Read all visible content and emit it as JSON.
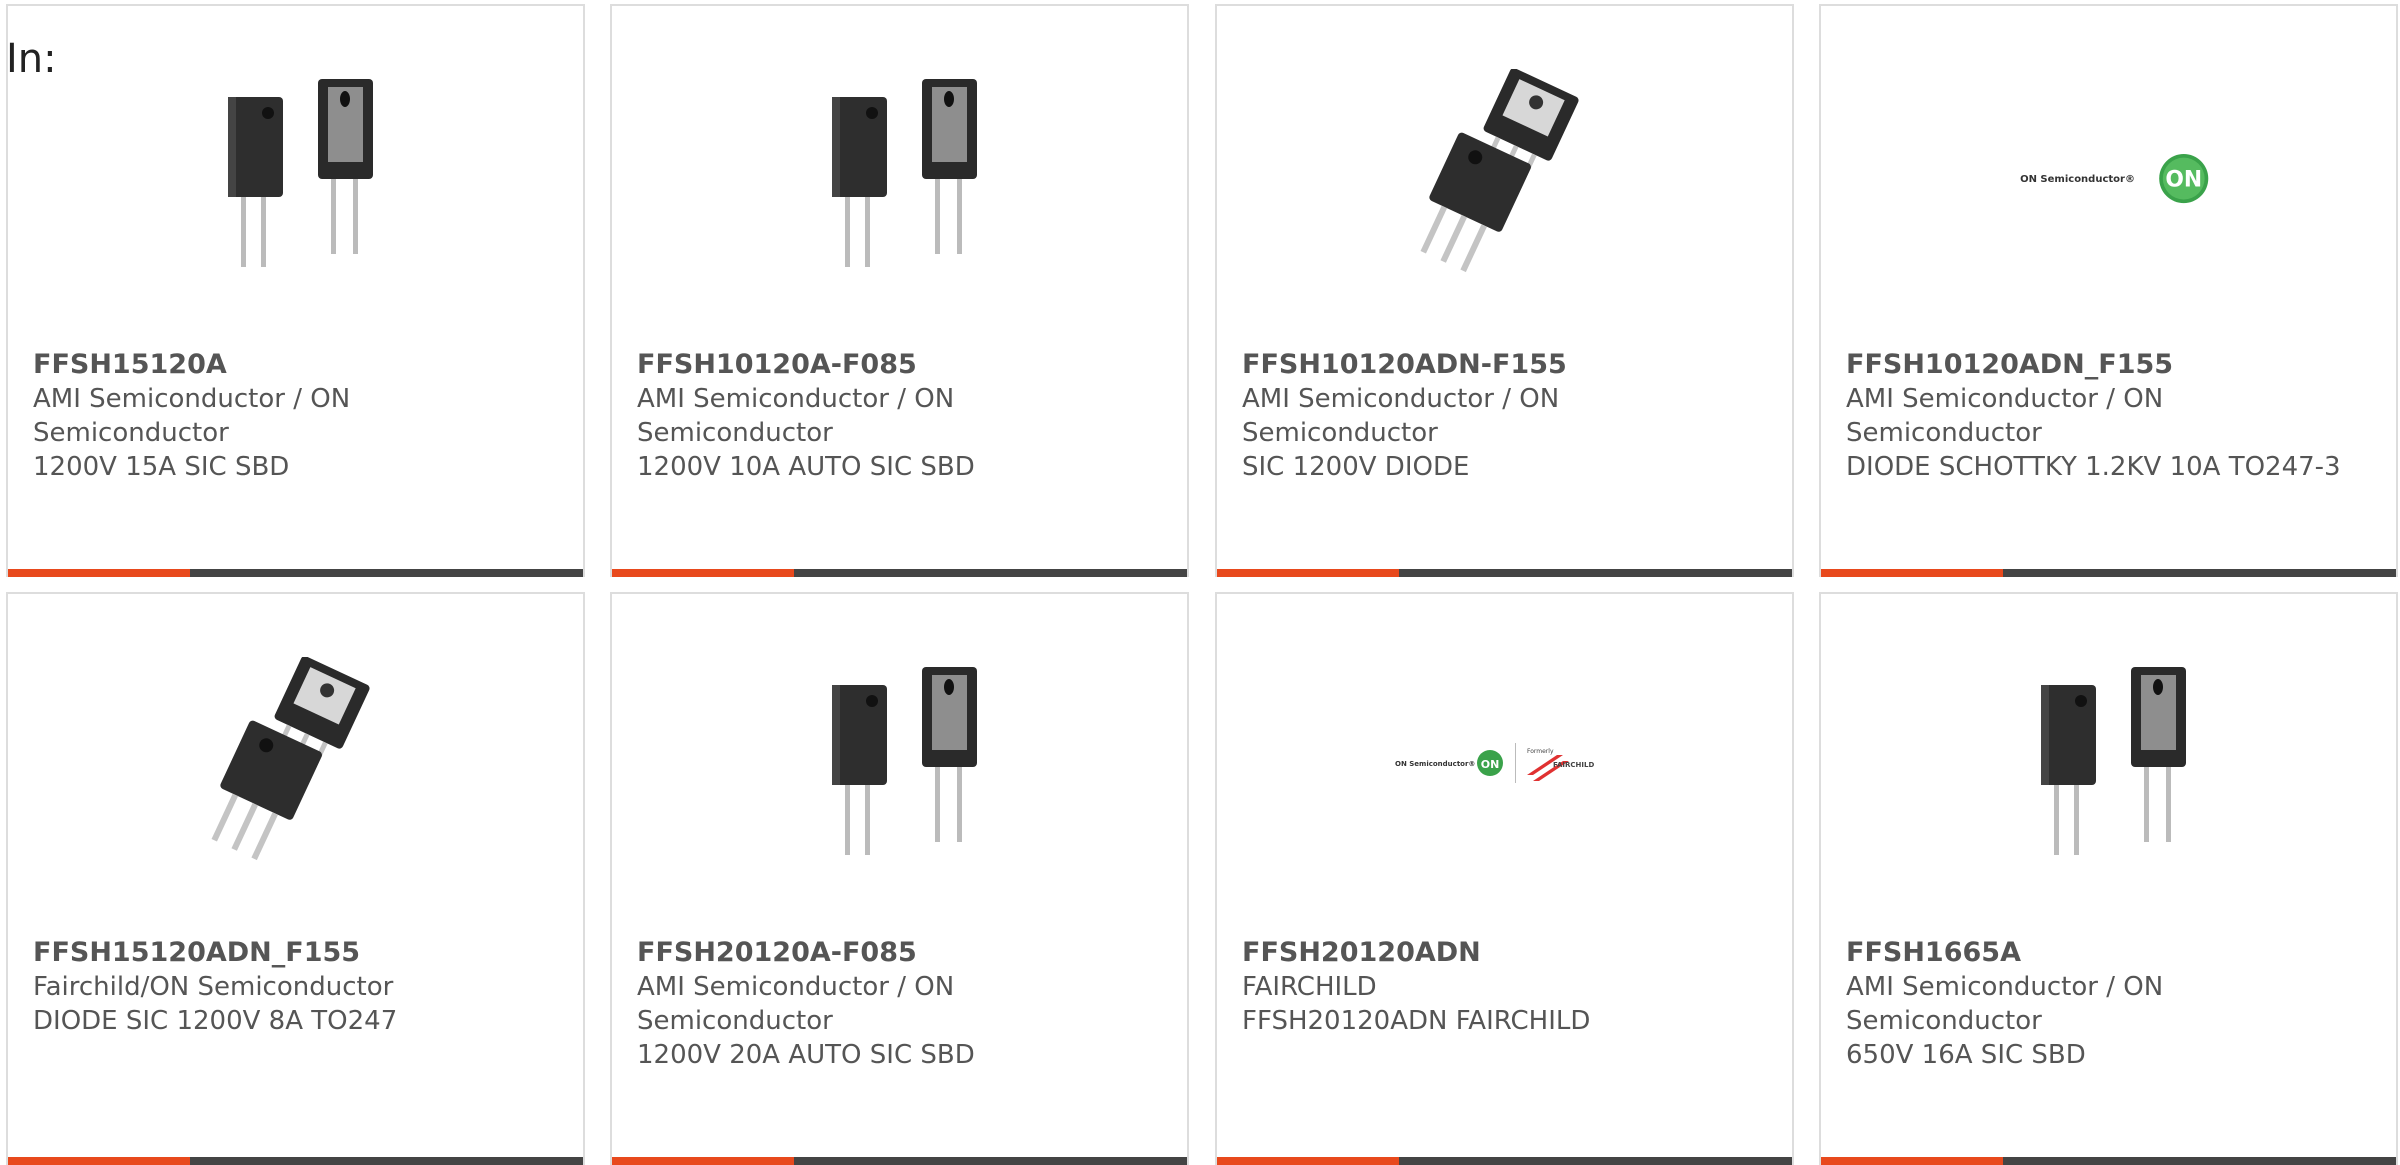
{
  "header": {
    "label": "In:"
  },
  "colors": {
    "accent": "#e8491d",
    "bar": "#444444",
    "border": "#dddddd",
    "text": "#555555"
  },
  "products": [
    {
      "part": "FFSH15120A",
      "manufacturer": "AMI Semiconductor / ON Semiconductor",
      "description": "1200V 15A SIC SBD",
      "image": "to247-2lead-image"
    },
    {
      "part": "FFSH10120A-F085",
      "manufacturer": "AMI Semiconductor / ON Semiconductor",
      "description": "1200V 10A AUTO SIC SBD",
      "image": "to247-2lead-image"
    },
    {
      "part": "FFSH10120ADN-F155",
      "manufacturer": "AMI Semiconductor / ON Semiconductor",
      "description": "SIC 1200V DIODE",
      "image": "to247-3lead-image"
    },
    {
      "part": "FFSH10120ADN_F155",
      "manufacturer": "AMI Semiconductor / ON Semiconductor",
      "description": "DIODE SCHOTTKY 1.2KV 10A TO247-3",
      "image": "on-semiconductor-logo",
      "logo_text": "ON Semiconductor®",
      "logo_badge": "ON"
    },
    {
      "part": "FFSH15120ADN_F155",
      "manufacturer": "Fairchild/ON Semiconductor",
      "description": "DIODE SIC 1200V 8A TO247",
      "image": "to247-3lead-image"
    },
    {
      "part": "FFSH20120A-F085",
      "manufacturer": "AMI Semiconductor / ON Semiconductor",
      "description": "1200V 20A AUTO SIC SBD",
      "image": "to247-2lead-image"
    },
    {
      "part": "FFSH20120ADN",
      "manufacturer": "FAIRCHILD",
      "description": "FFSH20120ADN FAIRCHILD",
      "image": "on-fairchild-logo",
      "logo_text": "ON Semiconductor®",
      "logo_badge": "ON",
      "logo_text2": "Formerly",
      "logo_text3": "FAIRCHILD"
    },
    {
      "part": "FFSH1665A",
      "manufacturer": "AMI Semiconductor / ON Semiconductor",
      "description": "650V 16A SIC SBD",
      "image": "to247-2lead-image"
    }
  ]
}
